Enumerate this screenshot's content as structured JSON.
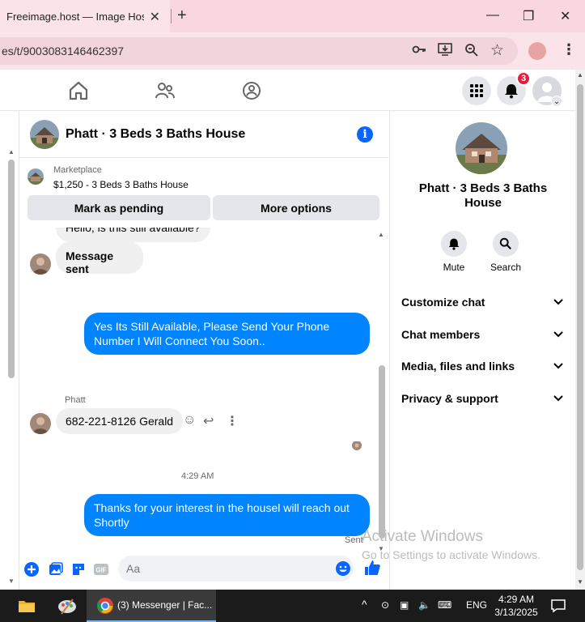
{
  "browser": {
    "tab_title": "Freeimage.host — Image Hostin",
    "url": "es/t/9003083146462397"
  },
  "header": {
    "notification_count": "3"
  },
  "chat": {
    "title": "Phatt · 3 Beds 3 Baths House",
    "marketplace_label": "Marketplace",
    "listing": "$1,250 - 3 Beds 3 Baths House",
    "mark_pending": "Mark as pending",
    "more_options": "More options",
    "partial_message": "Hello, is this still available?",
    "msg_sent": "Message sent",
    "reply1": "Yes Its Still Available, Please Send Your Phone Number I Will Connect You Soon..",
    "sender": "Phatt",
    "phone_msg": "682-221-8126 Gerald",
    "time": "4:29 AM",
    "reply2": "Thanks for your interest in the housel will reach out Shortly",
    "status": "Sent",
    "placeholder": "Aa"
  },
  "panel": {
    "title": "Phatt · 3 Beds 3 Baths House",
    "mute": "Mute",
    "search": "Search",
    "sections": [
      "Customize chat",
      "Chat members",
      "Media, files and links",
      "Privacy & support"
    ]
  },
  "watermark": {
    "line1": "Activate Windows",
    "line2": "Go to Settings to activate Windows."
  },
  "taskbar": {
    "app": "(3) Messenger | Fac...",
    "lang": "ENG",
    "time": "4:29 AM",
    "date": "3/13/2025"
  },
  "colors": {
    "accent": "#0084ff",
    "badge": "#e41e3f",
    "tabstrip": "#f9d7de"
  }
}
